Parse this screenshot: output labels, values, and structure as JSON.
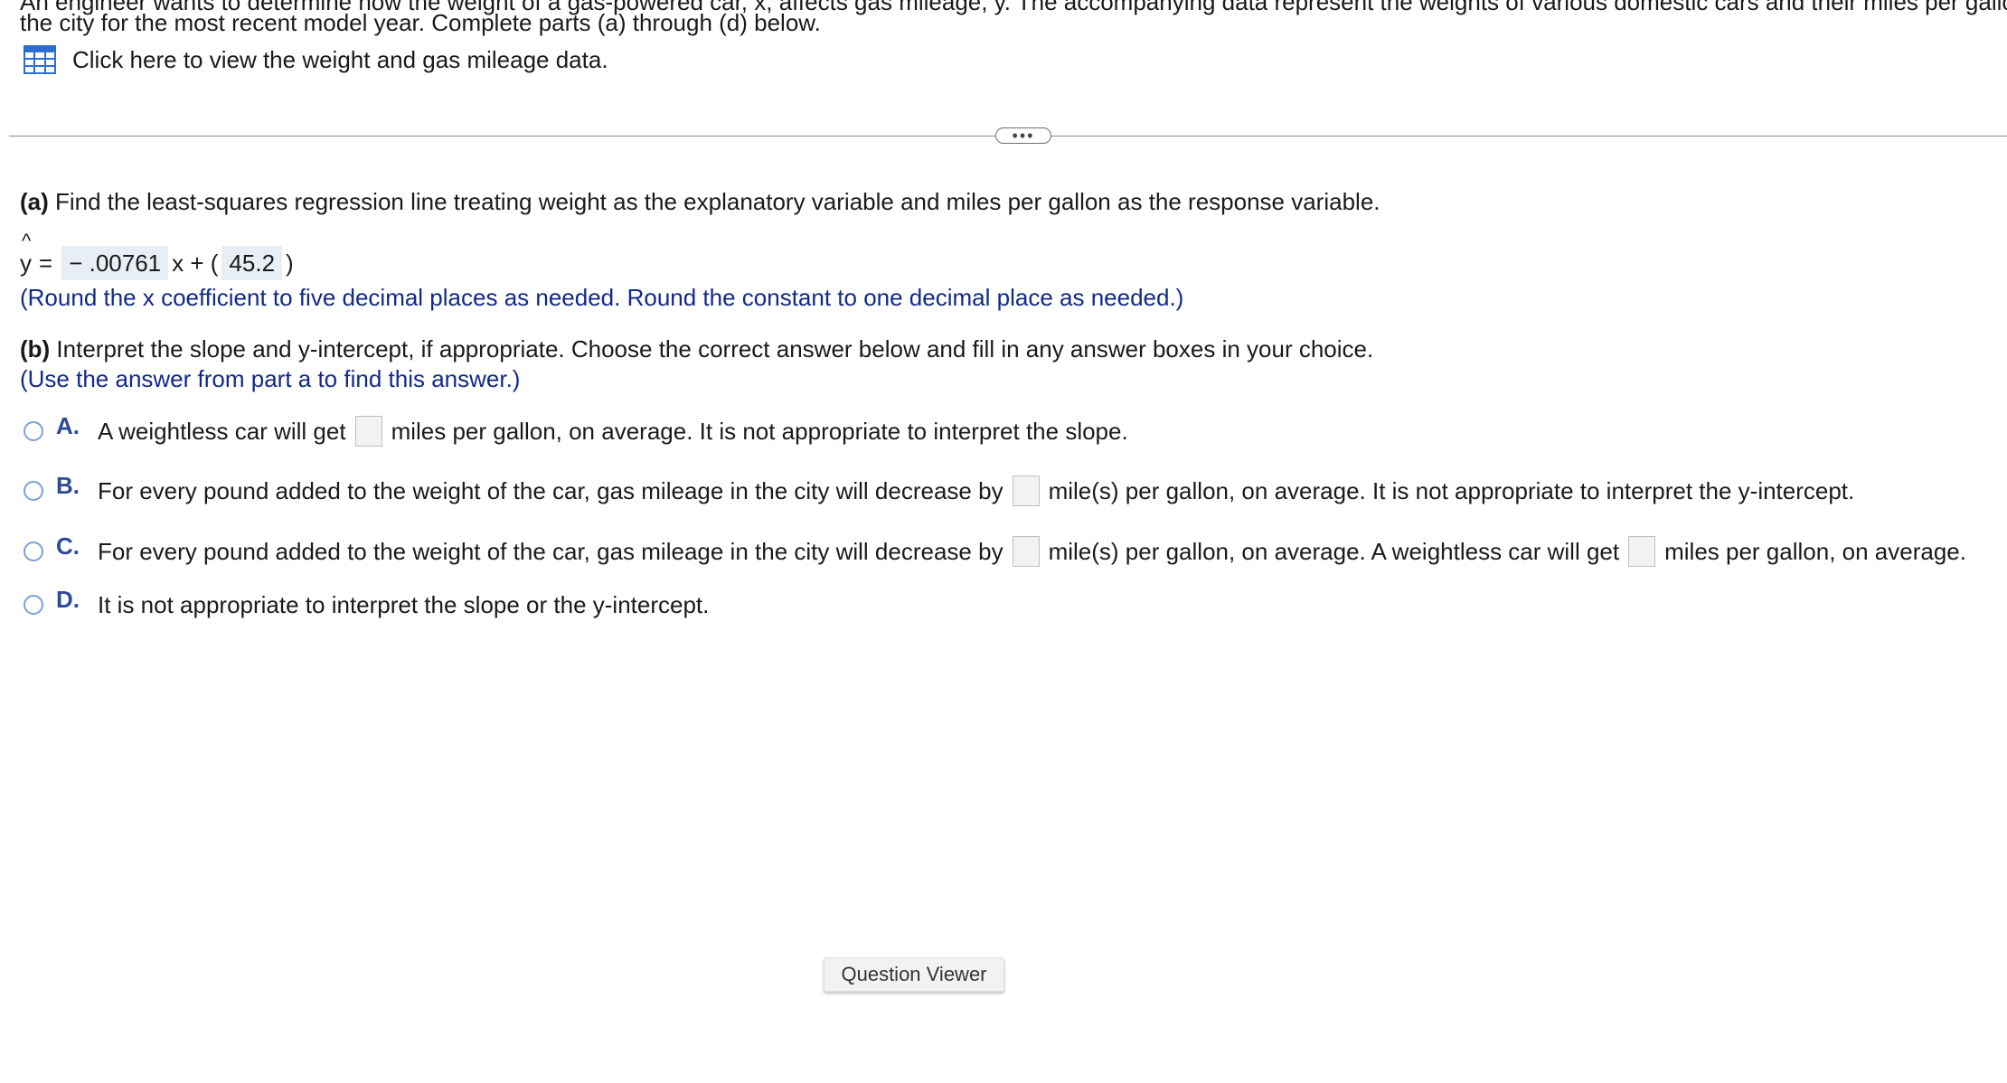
{
  "intro": {
    "cut_line": "An engineer wants to determine how the weight of a gas-powered car, x, affects gas mileage, y. The accompanying data represent the weights of various domestic cars and their miles per gallon in",
    "line2": "the city for the most recent model year. Complete parts (a) through (d) below.",
    "data_link": "Click here to view the weight and gas mileage data.",
    "data_link_icon": "table-grid-icon"
  },
  "divider": {
    "expand_label": "•••"
  },
  "part_a": {
    "label": "(a)",
    "question": " Find the least-squares regression line treating weight as the explanatory variable and miles per gallon as the response variable.",
    "yhat": "y",
    "equals": "=",
    "slope_answer": "− .00761",
    "x_plus": "x + (",
    "intercept_answer": "45.2",
    "close_paren": ")",
    "round_note": "(Round the x coefficient to five decimal places as needed. Round the constant to one decimal place as needed.)"
  },
  "part_b": {
    "label": "(b)",
    "question": " Interpret the slope and y-intercept, if appropriate. Choose the correct answer below and fill in any answer boxes in your choice.",
    "note": "(Use the answer from part a to find this answer.)",
    "choices": [
      {
        "letter": "A.",
        "text1": "A weightless car will get",
        "text2": "miles per gallon, on average. It is not appropriate to interpret the slope."
      },
      {
        "letter": "B.",
        "text1": "For every pound added to the weight of the car, gas mileage in the city will decrease by",
        "text2": "mile(s) per gallon, on average. It is not appropriate to interpret the y-intercept."
      },
      {
        "letter": "C.",
        "text1": "For every pound added to the weight of the car, gas mileage in the city will decrease by",
        "text2": "mile(s) per gallon, on average. A weightless car will get",
        "text3": "miles per gallon, on average."
      },
      {
        "letter": "D.",
        "text1": "It is not appropriate to interpret the slope or the y-intercept."
      }
    ]
  },
  "footer": {
    "question_viewer": "Question Viewer"
  },
  "colors": {
    "note_blue": "#12298a",
    "choice_letter_blue": "#2b4a9a",
    "radio_border": "#7aa0d8",
    "answer_box_bg": "#e8eef5"
  }
}
